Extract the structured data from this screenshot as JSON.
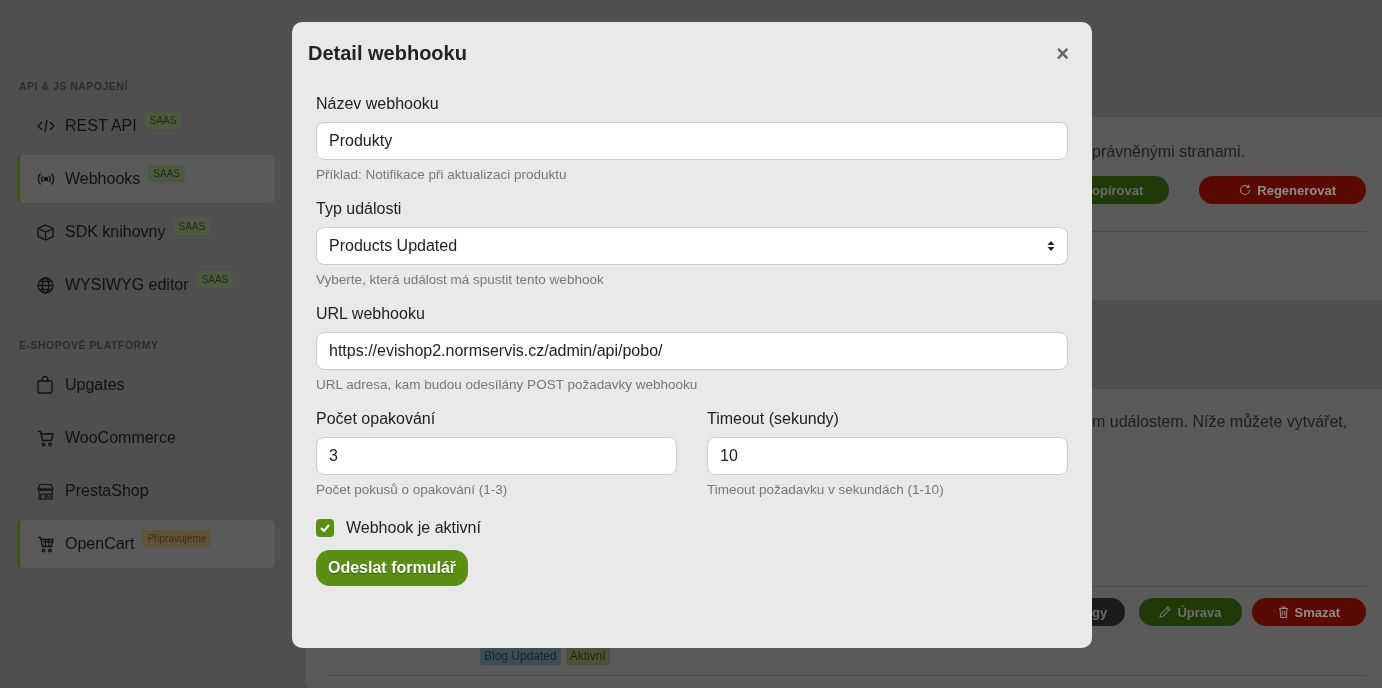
{
  "sidebar": {
    "sections": [
      {
        "heading": "API & JS NAPOJENÍ",
        "items": [
          {
            "label": "REST API",
            "badge": {
              "text": "SAAS",
              "kind": "saas"
            },
            "selected": false
          },
          {
            "label": "Webhooks",
            "badge": {
              "text": "SAAS",
              "kind": "saas"
            },
            "selected": true
          },
          {
            "label": "SDK knihovny",
            "badge": {
              "text": "SAAS",
              "kind": "saas"
            },
            "selected": false
          },
          {
            "label": "WYSIWYG editor",
            "badge": {
              "text": "SAAS",
              "kind": "saas"
            },
            "selected": false
          }
        ]
      },
      {
        "heading": "E-SHOPOVÉ PLATFORMY",
        "items": [
          {
            "label": "Upgates",
            "selected": false
          },
          {
            "label": "WooCommerce",
            "selected": false
          },
          {
            "label": "PrestaShop",
            "selected": false
          },
          {
            "label": "OpenCart",
            "badge": {
              "text": "Připravujeme",
              "kind": "soon"
            },
            "selected": true
          }
        ]
      }
    ]
  },
  "main": {
    "panels": [
      {
        "text": "právněnými stranami.",
        "buttons": [
          {
            "label": "opírovat",
            "kind": "success"
          },
          {
            "label": "Regenerovat",
            "kind": "danger"
          }
        ]
      },
      {
        "text": "m událostem. Níže můžete vytvářet,",
        "buttons": [
          {
            "label": "gy",
            "kind": "dark"
          },
          {
            "label": "Úprava",
            "kind": "success"
          },
          {
            "label": "Smazat",
            "kind": "danger"
          }
        ],
        "tags": [
          {
            "text": "Blog Updated",
            "kind": "event"
          },
          {
            "text": "Aktivní",
            "kind": "status"
          }
        ]
      }
    ]
  },
  "modal": {
    "title": "Detail webhooku",
    "close": "×",
    "fields": [
      {
        "kind": "text",
        "label": "Název webhooku",
        "value": "Produkty",
        "help": "Příklad: Notifikace při aktualizaci produktu"
      },
      {
        "kind": "select",
        "label": "Typ události",
        "value": "Products Updated",
        "help": "Vyberte, která událost má spustit tento webhook"
      },
      {
        "kind": "text",
        "label": "URL webhooku",
        "value": "https://evishop2.normservis.cz/admin/api/pobo/",
        "help": "URL adresa, kam budou odesílány POST požadavky webhooku"
      }
    ],
    "field_pair": [
      {
        "label": "Počet opakování",
        "value": "3",
        "help": "Počet pokusů o opakování (1-3)"
      },
      {
        "label": "Timeout (sekundy)",
        "value": "10",
        "help": "Timeout požadavku v sekundách (1-10)"
      }
    ],
    "checkbox": {
      "label": "Webhook je aktivní",
      "checked": true
    },
    "submit": "Odeslat formulář"
  }
}
